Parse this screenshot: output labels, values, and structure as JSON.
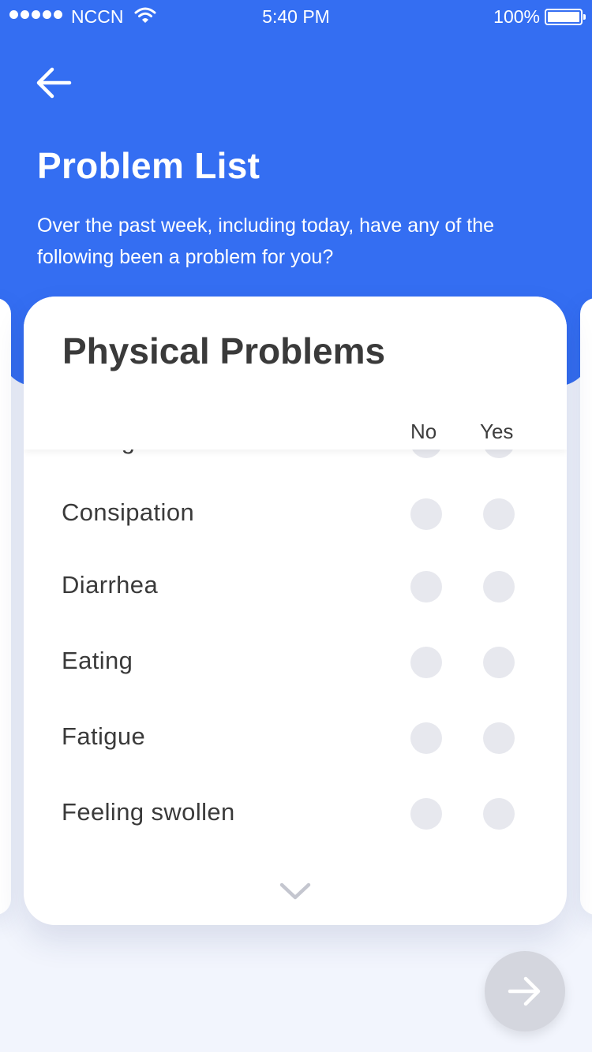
{
  "status_bar": {
    "carrier": "NCCN",
    "time": "5:40 PM",
    "battery": "100%"
  },
  "header": {
    "title": "Problem List",
    "subtitle": "Over the past week, including today, have any of the following been a problem for you?"
  },
  "card": {
    "title": "Physical Problems",
    "columns": {
      "no": "No",
      "yes": "Yes"
    },
    "items": [
      {
        "label": "Changes in urination"
      },
      {
        "label": "Consipation"
      },
      {
        "label": "Diarrhea"
      },
      {
        "label": "Eating"
      },
      {
        "label": "Fatigue"
      },
      {
        "label": "Feeling swollen"
      }
    ]
  },
  "colors": {
    "header_blue": "#346ef2",
    "radio_unselected": "#e7e8ee",
    "next_button_disabled": "#d4d6de"
  },
  "icons": {
    "back": "arrow-left-icon",
    "scroll": "chevron-down-icon",
    "next": "arrow-right-icon"
  }
}
